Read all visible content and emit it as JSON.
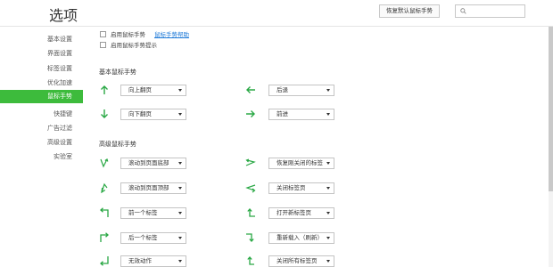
{
  "header": {
    "title": "选项",
    "restore_button": "恢复默认鼠标手势",
    "search_placeholder": ""
  },
  "sidebar": {
    "items": [
      {
        "label": "基本设置"
      },
      {
        "label": "界面设置"
      },
      {
        "label": "标签设置"
      },
      {
        "label": "优化加速"
      },
      {
        "label": "鼠标手势",
        "active": true
      },
      {
        "label": "快捷键"
      },
      {
        "label": "广告过滤"
      },
      {
        "label": "高级设置"
      },
      {
        "label": "实验室"
      }
    ]
  },
  "options": {
    "enable_gesture": "启用鼠标手势",
    "help_link": "鼠标手势帮助",
    "enable_hint": "启用鼠标手势提示"
  },
  "basic": {
    "title": "基本鼠标手势",
    "gestures": [
      {
        "icon": "arrow-up-icon",
        "action": "向上翻页"
      },
      {
        "icon": "arrow-left-icon",
        "action": "后退"
      },
      {
        "icon": "arrow-down-icon",
        "action": "向下翻页"
      },
      {
        "icon": "arrow-right-icon",
        "action": "前进"
      }
    ]
  },
  "advanced": {
    "title": "高级鼠标手势",
    "gestures": [
      {
        "icon": "gesture-down-up-icon",
        "action": "滚动到页面底部"
      },
      {
        "icon": "gesture-right-left-icon",
        "action": "恢复刚关闭的标签"
      },
      {
        "icon": "gesture-up-down-icon",
        "action": "滚动到页面顶部"
      },
      {
        "icon": "gesture-left-right-icon",
        "action": "关闭标签页"
      },
      {
        "icon": "gesture-up-left-icon",
        "action": "前一个标签"
      },
      {
        "icon": "gesture-left-up-icon",
        "action": "打开新标签页"
      },
      {
        "icon": "gesture-up-right-icon",
        "action": "后一个标签"
      },
      {
        "icon": "gesture-right-down-icon",
        "action": "重新载入（刷新）"
      },
      {
        "icon": "gesture-down-left-icon",
        "action": "无效动作"
      },
      {
        "icon": "gesture-left-up-alt-icon",
        "action": "关闭所有标签页"
      }
    ]
  },
  "colors": {
    "accent": "#3dbb3c",
    "link": "#1e7ad8",
    "arrow": "#2aa845"
  }
}
